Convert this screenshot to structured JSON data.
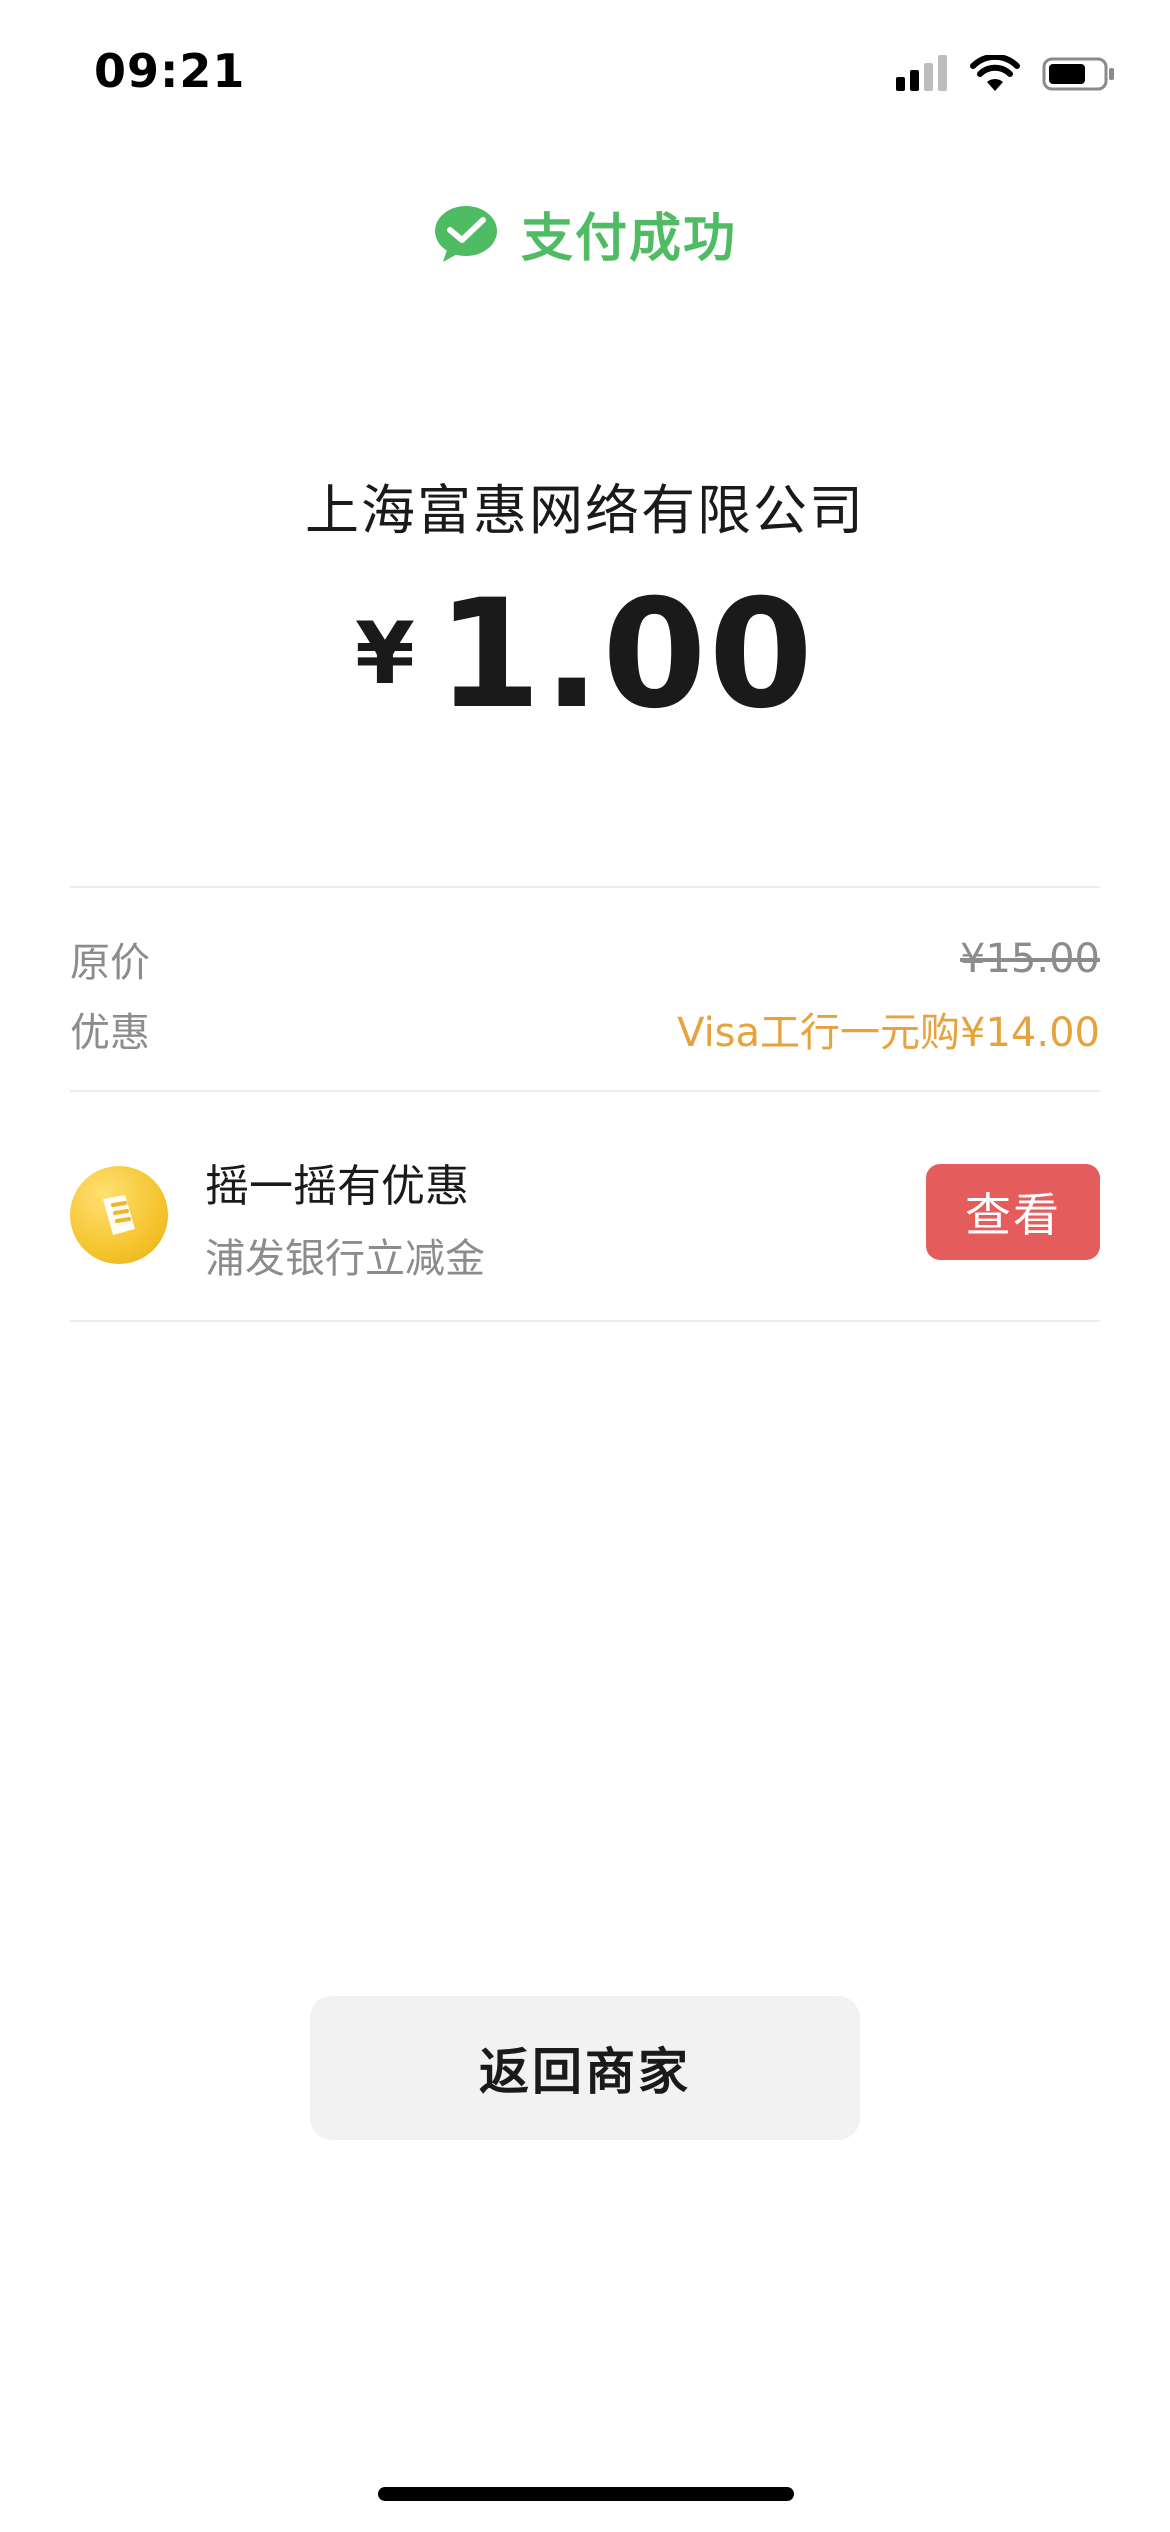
{
  "status_bar": {
    "time": "09:21",
    "icons": [
      "signal-icon",
      "wifi-icon",
      "battery-icon"
    ]
  },
  "header": {
    "title": "支付成功",
    "icon": "wechat-pay-check-icon",
    "color": "#4fbb63"
  },
  "payment": {
    "merchant": "上海富惠网络有限公司",
    "currency_symbol": "¥",
    "amount": "1.00"
  },
  "details": {
    "original_label": "原价",
    "original_value": "¥15.00",
    "discount_label": "优惠",
    "discount_value": "Visa工行一元购¥14.00",
    "discount_color": "#e6a23c"
  },
  "promo": {
    "icon": "shake-coupon-icon",
    "title": "摇一摇有优惠",
    "subtitle": "浦发银行立减金",
    "button_label": "查看",
    "button_color": "#e45c5b"
  },
  "footer": {
    "back_label": "返回商家"
  }
}
